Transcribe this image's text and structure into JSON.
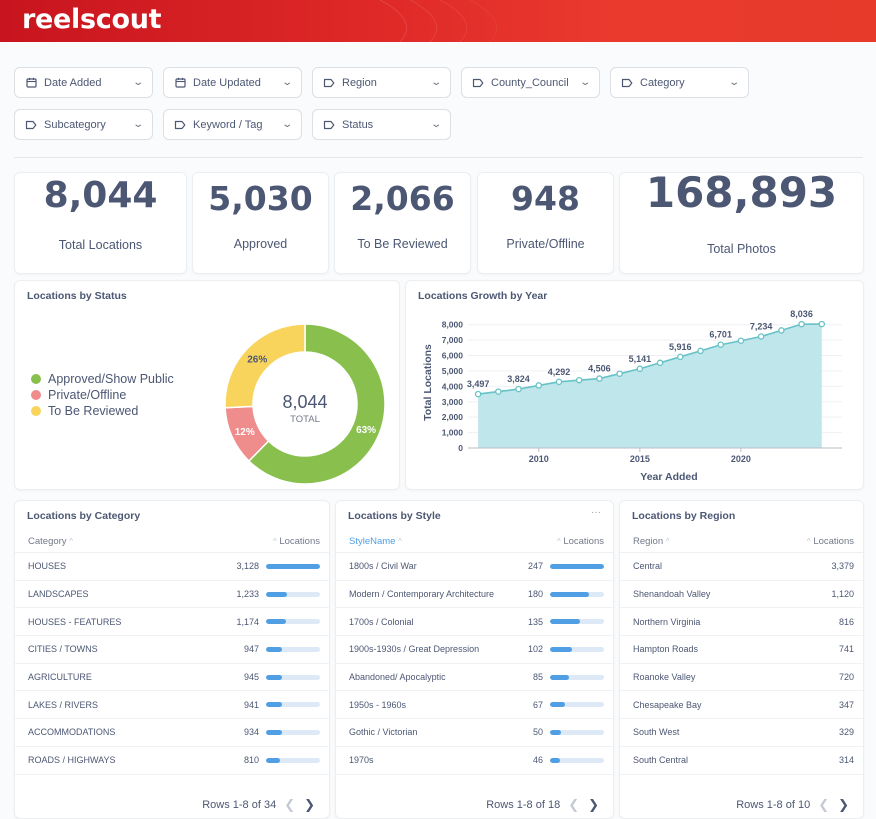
{
  "app": {
    "logo": "reelscout"
  },
  "filters": [
    {
      "label": "Date Added",
      "icon": "calendar-icon"
    },
    {
      "label": "Date Updated",
      "icon": "calendar-icon"
    },
    {
      "label": "Region",
      "icon": "tag-icon"
    },
    {
      "label": "County_Council",
      "icon": "tag-icon"
    },
    {
      "label": "Category",
      "icon": "tag-icon"
    },
    {
      "label": "Subcategory",
      "icon": "tag-icon"
    },
    {
      "label": "Keyword / Tag",
      "icon": "tag-icon"
    },
    {
      "label": "Status",
      "icon": "tag-icon"
    }
  ],
  "kpis": [
    {
      "value": "8,044",
      "label": "Total Locations"
    },
    {
      "value": "5,030",
      "label": "Approved"
    },
    {
      "value": "2,066",
      "label": "To Be Reviewed"
    },
    {
      "value": "948",
      "label": "Private/Offline"
    },
    {
      "value": "168,893",
      "label": "Total Photos"
    }
  ],
  "status_chart": {
    "title": "Locations by Status",
    "center_value": "8,044",
    "center_label": "TOTAL",
    "chart_data": {
      "type": "pie",
      "categories": [
        "Approved/Show Public",
        "Private/Offline",
        "To Be Reviewed"
      ],
      "values": [
        63,
        12,
        26
      ],
      "labels": [
        "63%",
        "12%",
        "26%"
      ],
      "colors": [
        "#88bf4d",
        "#ef8c8c",
        "#f9d45c"
      ]
    }
  },
  "growth_chart": {
    "title": "Locations Growth by Year",
    "chart_data": {
      "type": "area",
      "xlabel": "Year Added",
      "ylabel": "Total Locations",
      "xticks": [
        "2010",
        "2015",
        "2020"
      ],
      "yticks": [
        "0",
        "1,000",
        "2,000",
        "3,000",
        "4,000",
        "5,000",
        "6,000",
        "7,000",
        "8,000"
      ],
      "ylim": [
        0,
        8500
      ],
      "xlim": [
        2006.5,
        2025
      ],
      "x": [
        2007,
        2008,
        2009,
        2010,
        2011,
        2012,
        2013,
        2014,
        2015,
        2016,
        2017,
        2018,
        2019,
        2020,
        2021,
        2022,
        2023,
        2024
      ],
      "values": [
        3497,
        3660,
        3824,
        4060,
        4292,
        4400,
        4506,
        4820,
        5141,
        5530,
        5916,
        6300,
        6701,
        6960,
        7234,
        7630,
        8036,
        8040
      ],
      "labels": [
        {
          "x": 2007,
          "text": "3,497"
        },
        {
          "x": 2009,
          "text": "3,824"
        },
        {
          "x": 2011,
          "text": "4,292"
        },
        {
          "x": 2013,
          "text": "4,506"
        },
        {
          "x": 2015,
          "text": "5,141"
        },
        {
          "x": 2017,
          "text": "5,916"
        },
        {
          "x": 2019,
          "text": "6,701"
        },
        {
          "x": 2021,
          "text": "7,234"
        },
        {
          "x": 2023,
          "text": "8,036"
        }
      ],
      "colors": {
        "line": "#67c2c7",
        "fill": "#bfe6ea"
      }
    }
  },
  "tables": [
    {
      "title": "Locations by Category",
      "col1": "Category",
      "col2": "Locations",
      "sort_active": false,
      "show_bars": true,
      "max": 3128,
      "rows": [
        {
          "name": "HOUSES",
          "value": "3,128",
          "n": 3128
        },
        {
          "name": "LANDSCAPES",
          "value": "1,233",
          "n": 1233
        },
        {
          "name": "HOUSES - FEATURES",
          "value": "1,174",
          "n": 1174
        },
        {
          "name": "CITIES / TOWNS",
          "value": "947",
          "n": 947
        },
        {
          "name": "AGRICULTURE",
          "value": "945",
          "n": 945
        },
        {
          "name": "LAKES / RIVERS",
          "value": "941",
          "n": 941
        },
        {
          "name": "ACCOMMODATIONS",
          "value": "934",
          "n": 934
        },
        {
          "name": "ROADS / HIGHWAYS",
          "value": "810",
          "n": 810
        }
      ],
      "pager": "Rows 1-8 of 34"
    },
    {
      "title": "Locations by Style",
      "col1": "StyleName",
      "col2": "Locations",
      "sort_active": true,
      "show_bars": true,
      "max": 247,
      "more": "···",
      "rows": [
        {
          "name": "1800s / Civil War",
          "value": "247",
          "n": 247
        },
        {
          "name": "Modern / Contemporary Architecture",
          "value": "180",
          "n": 180
        },
        {
          "name": "1700s / Colonial",
          "value": "135",
          "n": 135
        },
        {
          "name": "1900s-1930s / Great Depression",
          "value": "102",
          "n": 102
        },
        {
          "name": "Abandoned/ Apocalyptic",
          "value": "85",
          "n": 85
        },
        {
          "name": "1950s - 1960s",
          "value": "67",
          "n": 67
        },
        {
          "name": "Gothic / Victorian",
          "value": "50",
          "n": 50
        },
        {
          "name": "1970s",
          "value": "46",
          "n": 46
        }
      ],
      "pager": "Rows 1-8 of 18"
    },
    {
      "title": "Locations by Region",
      "col1": "Region",
      "col2": "Locations",
      "sort_active": false,
      "show_bars": false,
      "rows": [
        {
          "name": "Central",
          "value": "3,379",
          "n": 3379
        },
        {
          "name": "Shenandoah Valley",
          "value": "1,120",
          "n": 1120
        },
        {
          "name": "Northern Virginia",
          "value": "816",
          "n": 816
        },
        {
          "name": "Hampton Roads",
          "value": "741",
          "n": 741
        },
        {
          "name": "Roanoke Valley",
          "value": "720",
          "n": 720
        },
        {
          "name": "Chesapeake Bay",
          "value": "347",
          "n": 347
        },
        {
          "name": "South West",
          "value": "329",
          "n": 329
        },
        {
          "name": "South Central",
          "value": "314",
          "n": 314
        }
      ],
      "pager": "Rows 1-8 of 10"
    }
  ]
}
